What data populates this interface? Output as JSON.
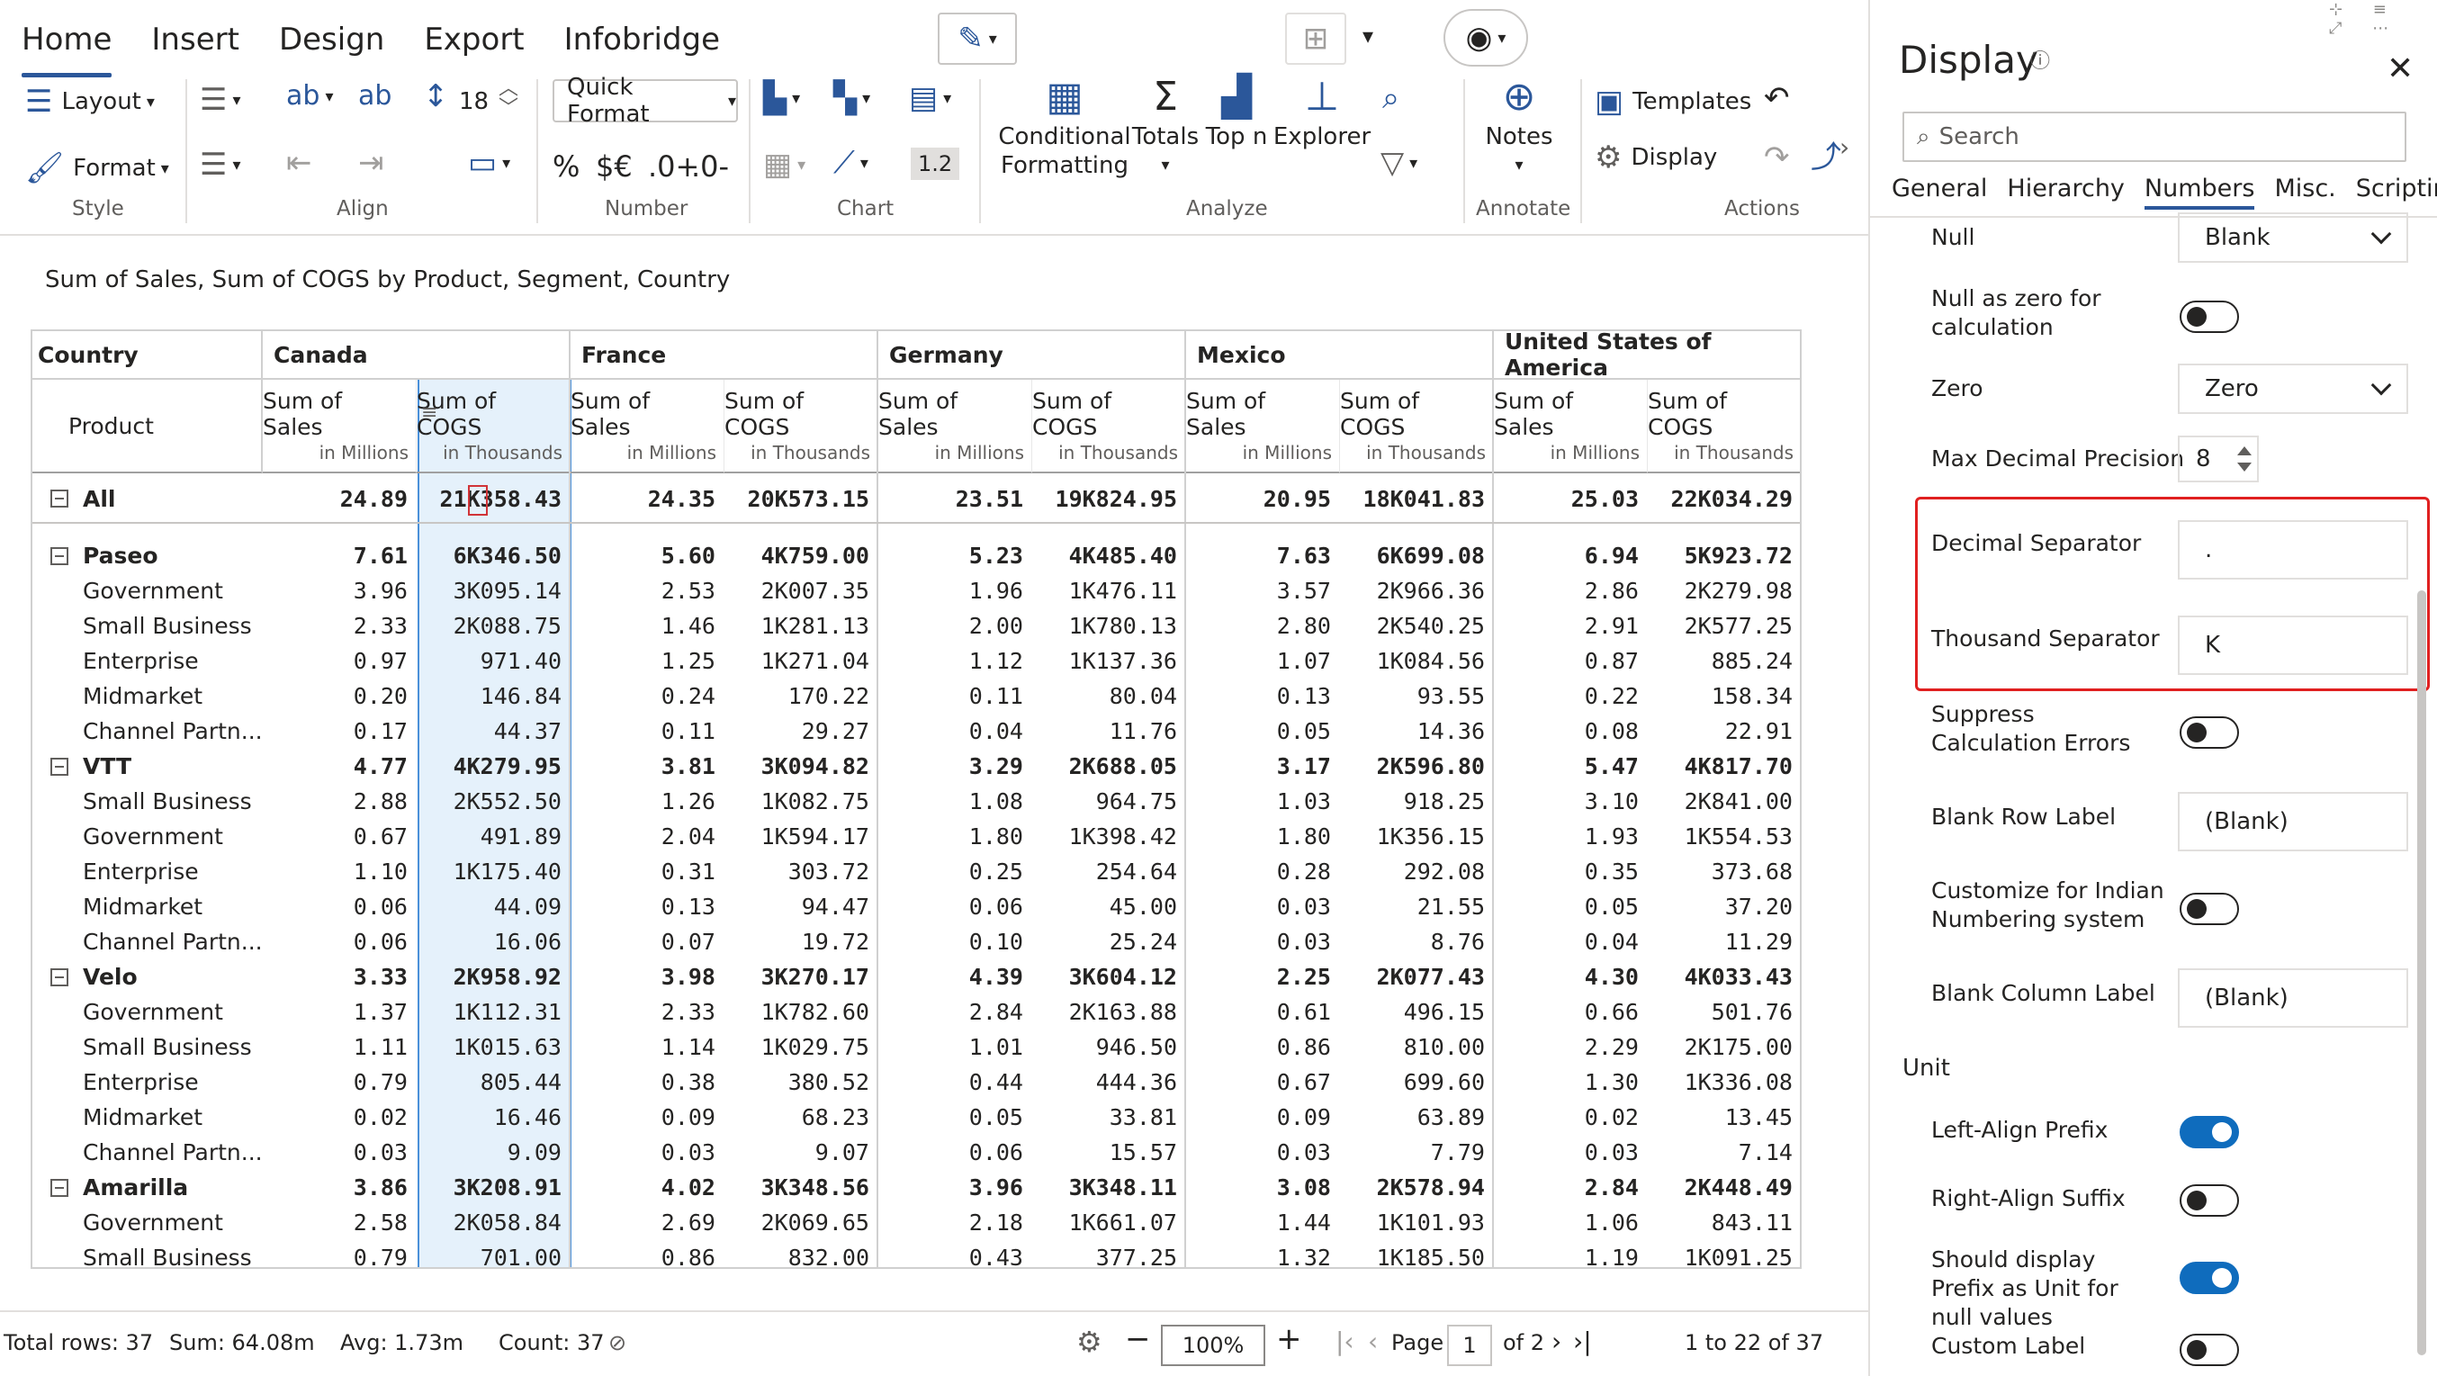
{
  "ribbon": {
    "tabs": [
      "Home",
      "Insert",
      "Design",
      "Export",
      "Infobridge"
    ],
    "groups": [
      "Style",
      "Align",
      "Number",
      "Chart",
      "Analyze",
      "Annotate",
      "Actions"
    ],
    "layout_label": "Layout",
    "format_label": "Format",
    "font_size": "18",
    "quick_format_label": "Quick Format",
    "number_symbols": [
      "%",
      "$€",
      ".0+",
      ".0-"
    ],
    "precision_badge": "1.2",
    "conditional_formatting_label": "Conditional Formatting",
    "totals_label": "Totals",
    "topn_label": "Top n",
    "explorer_label": "Explorer",
    "notes_label": "Notes",
    "templates_label": "Templates",
    "display_label": "Display"
  },
  "report": {
    "subtitle": "Sum of Sales, Sum of COGS by Product, Segment, Country",
    "country_header": "Country",
    "product_header": "Product",
    "countries": [
      "Canada",
      "France",
      "Germany",
      "Mexico",
      "United States of America"
    ],
    "measures": [
      {
        "name": "Sum of Sales",
        "unit": "in Millions"
      },
      {
        "name": "Sum of COGS",
        "unit": "in Thousands"
      }
    ],
    "rows": [
      {
        "label": "All",
        "level": "all",
        "values": [
          "24.89",
          "21K358.43",
          "24.35",
          "20K573.15",
          "23.51",
          "19K824.95",
          "20.95",
          "18K041.83",
          "25.03",
          "22K034.29"
        ]
      },
      {
        "label": "Paseo",
        "level": "l1",
        "values": [
          "7.61",
          "6K346.50",
          "5.60",
          "4K759.00",
          "5.23",
          "4K485.40",
          "7.63",
          "6K699.08",
          "6.94",
          "5K923.72"
        ]
      },
      {
        "label": "Government",
        "level": "l2",
        "values": [
          "3.96",
          "3K095.14",
          "2.53",
          "2K007.35",
          "1.96",
          "1K476.11",
          "3.57",
          "2K966.36",
          "2.86",
          "2K279.98"
        ]
      },
      {
        "label": "Small Business",
        "level": "l2",
        "values": [
          "2.33",
          "2K088.75",
          "1.46",
          "1K281.13",
          "2.00",
          "1K780.13",
          "2.80",
          "2K540.25",
          "2.91",
          "2K577.25"
        ]
      },
      {
        "label": "Enterprise",
        "level": "l2",
        "values": [
          "0.97",
          "971.40",
          "1.25",
          "1K271.04",
          "1.12",
          "1K137.36",
          "1.07",
          "1K084.56",
          "0.87",
          "885.24"
        ]
      },
      {
        "label": "Midmarket",
        "level": "l2",
        "values": [
          "0.20",
          "146.84",
          "0.24",
          "170.22",
          "0.11",
          "80.04",
          "0.13",
          "93.55",
          "0.22",
          "158.34"
        ]
      },
      {
        "label": "Channel Partn...",
        "level": "l2",
        "values": [
          "0.17",
          "44.37",
          "0.11",
          "29.27",
          "0.04",
          "11.76",
          "0.05",
          "14.36",
          "0.08",
          "22.91"
        ]
      },
      {
        "label": "VTT",
        "level": "l1",
        "values": [
          "4.77",
          "4K279.95",
          "3.81",
          "3K094.82",
          "3.29",
          "2K688.05",
          "3.17",
          "2K596.80",
          "5.47",
          "4K817.70"
        ]
      },
      {
        "label": "Small Business",
        "level": "l2",
        "values": [
          "2.88",
          "2K552.50",
          "1.26",
          "1K082.75",
          "1.08",
          "964.75",
          "1.03",
          "918.25",
          "3.10",
          "2K841.00"
        ]
      },
      {
        "label": "Government",
        "level": "l2",
        "values": [
          "0.67",
          "491.89",
          "2.04",
          "1K594.17",
          "1.80",
          "1K398.42",
          "1.80",
          "1K356.15",
          "1.93",
          "1K554.53"
        ]
      },
      {
        "label": "Enterprise",
        "level": "l2",
        "values": [
          "1.10",
          "1K175.40",
          "0.31",
          "303.72",
          "0.25",
          "254.64",
          "0.28",
          "292.08",
          "0.35",
          "373.68"
        ]
      },
      {
        "label": "Midmarket",
        "level": "l2",
        "values": [
          "0.06",
          "44.09",
          "0.13",
          "94.47",
          "0.06",
          "45.00",
          "0.03",
          "21.55",
          "0.05",
          "37.20"
        ]
      },
      {
        "label": "Channel Partn...",
        "level": "l2",
        "values": [
          "0.06",
          "16.06",
          "0.07",
          "19.72",
          "0.10",
          "25.24",
          "0.03",
          "8.76",
          "0.04",
          "11.29"
        ]
      },
      {
        "label": "Velo",
        "level": "l1",
        "values": [
          "3.33",
          "2K958.92",
          "3.98",
          "3K270.17",
          "4.39",
          "3K604.12",
          "2.25",
          "2K077.43",
          "4.30",
          "4K033.43"
        ]
      },
      {
        "label": "Government",
        "level": "l2",
        "values": [
          "1.37",
          "1K112.31",
          "2.33",
          "1K782.60",
          "2.84",
          "2K163.88",
          "0.61",
          "496.15",
          "0.66",
          "501.76"
        ]
      },
      {
        "label": "Small Business",
        "level": "l2",
        "values": [
          "1.11",
          "1K015.63",
          "1.14",
          "1K029.75",
          "1.01",
          "946.50",
          "0.86",
          "810.00",
          "2.29",
          "2K175.00"
        ]
      },
      {
        "label": "Enterprise",
        "level": "l2",
        "values": [
          "0.79",
          "805.44",
          "0.38",
          "380.52",
          "0.44",
          "444.36",
          "0.67",
          "699.60",
          "1.30",
          "1K336.08"
        ]
      },
      {
        "label": "Midmarket",
        "level": "l2",
        "values": [
          "0.02",
          "16.46",
          "0.09",
          "68.23",
          "0.05",
          "33.81",
          "0.09",
          "63.89",
          "0.02",
          "13.45"
        ]
      },
      {
        "label": "Channel Partn...",
        "level": "l2",
        "values": [
          "0.03",
          "9.09",
          "0.03",
          "9.07",
          "0.06",
          "15.57",
          "0.03",
          "7.79",
          "0.03",
          "7.14"
        ]
      },
      {
        "label": "Amarilla",
        "level": "l1",
        "values": [
          "3.86",
          "3K208.91",
          "4.02",
          "3K348.56",
          "3.96",
          "3K348.11",
          "3.08",
          "2K578.94",
          "2.84",
          "2K448.49"
        ]
      },
      {
        "label": "Government",
        "level": "l2",
        "values": [
          "2.58",
          "2K058.84",
          "2.69",
          "2K069.65",
          "2.18",
          "1K661.07",
          "1.44",
          "1K101.93",
          "1.06",
          "843.11"
        ]
      },
      {
        "label": "Small Business",
        "level": "l2",
        "values": [
          "0.79",
          "701.00",
          "0.86",
          "832.00",
          "0.43",
          "377.25",
          "1.32",
          "1K185.50",
          "1.19",
          "1K091.25"
        ]
      }
    ]
  },
  "status": {
    "total_rows": "Total rows: 37",
    "sum": "Sum: 64.08m",
    "avg": "Avg: 1.73m",
    "count": "Count: 37",
    "zoom": "100%",
    "page_label": "Page",
    "page": "1",
    "of_pages": "of 2",
    "range": "1 to 22 of 37"
  },
  "pane": {
    "title": "Display",
    "search_placeholder": "Search",
    "tabs": [
      "General",
      "Hierarchy",
      "Numbers",
      "Misc.",
      "Scripting"
    ],
    "null_label": "Null",
    "null_value": "Blank",
    "null_zero_label": "Null as zero for calculation",
    "zero_label": "Zero",
    "zero_value": "Zero",
    "max_decimal_label": "Max Decimal Precision",
    "max_decimal_value": "8",
    "decimal_sep_label": "Decimal Separator",
    "decimal_sep_value": ".",
    "thousand_sep_label": "Thousand Separator",
    "thousand_sep_value": "K",
    "suppress_label": "Suppress Calculation Errors",
    "blank_row_label": "Blank Row Label",
    "blank_row_value": "(Blank)",
    "indian_label": "Customize for Indian Numbering system",
    "blank_col_label": "Blank Column Label",
    "blank_col_value": "(Blank)",
    "unit_header": "Unit",
    "left_align_label": "Left-Align Prefix",
    "right_align_label": "Right-Align Suffix",
    "prefix_null_label": "Should display Prefix as Unit for null values",
    "custom_label": "Custom Label"
  },
  "colors": {
    "accent": "#0f6cbd",
    "ribbon_icon": "#2b579a",
    "highlight_box": "#e02020"
  }
}
